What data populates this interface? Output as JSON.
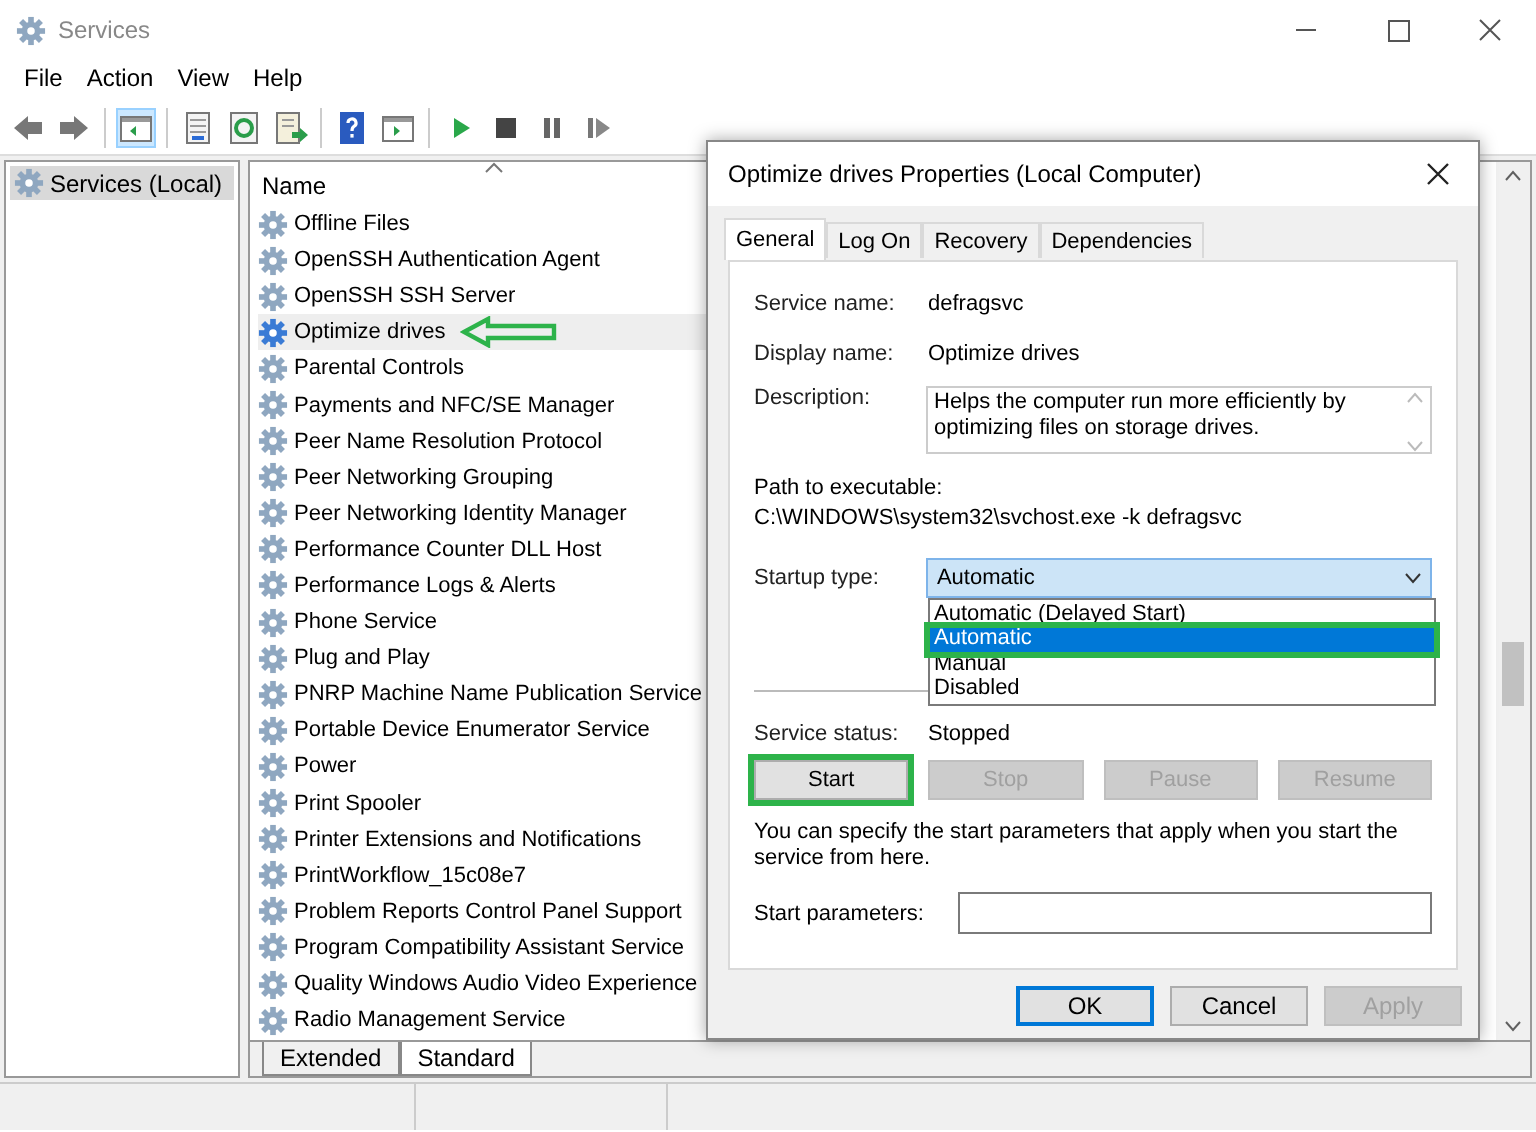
{
  "window": {
    "title": "Services"
  },
  "menu": [
    "File",
    "Action",
    "View",
    "Help"
  ],
  "tree": [
    {
      "label": "Services (Local)",
      "selected": true
    }
  ],
  "list": {
    "column": "Name",
    "rows": [
      {
        "name": "Offline Files",
        "selected": false,
        "annotated": false
      },
      {
        "name": "OpenSSH Authentication Agent",
        "selected": false,
        "annotated": false
      },
      {
        "name": "OpenSSH SSH Server",
        "selected": false,
        "annotated": false
      },
      {
        "name": "Optimize drives",
        "selected": true,
        "annotated": true
      },
      {
        "name": "Parental Controls",
        "selected": false,
        "annotated": false
      },
      {
        "name": "Payments and NFC/SE Manager",
        "selected": false,
        "annotated": false
      },
      {
        "name": "Peer Name Resolution Protocol",
        "selected": false,
        "annotated": false
      },
      {
        "name": "Peer Networking Grouping",
        "selected": false,
        "annotated": false
      },
      {
        "name": "Peer Networking Identity Manager",
        "selected": false,
        "annotated": false
      },
      {
        "name": "Performance Counter DLL Host",
        "selected": false,
        "annotated": false
      },
      {
        "name": "Performance Logs & Alerts",
        "selected": false,
        "annotated": false
      },
      {
        "name": "Phone Service",
        "selected": false,
        "annotated": false
      },
      {
        "name": "Plug and Play",
        "selected": false,
        "annotated": false
      },
      {
        "name": "PNRP Machine Name Publication Service",
        "selected": false,
        "annotated": false
      },
      {
        "name": "Portable Device Enumerator Service",
        "selected": false,
        "annotated": false
      },
      {
        "name": "Power",
        "selected": false,
        "annotated": false
      },
      {
        "name": "Print Spooler",
        "selected": false,
        "annotated": false
      },
      {
        "name": "Printer Extensions and Notifications",
        "selected": false,
        "annotated": false
      },
      {
        "name": "PrintWorkflow_15c08e7",
        "selected": false,
        "annotated": false
      },
      {
        "name": "Problem Reports Control Panel Support",
        "selected": false,
        "annotated": false
      },
      {
        "name": "Program Compatibility Assistant Service",
        "selected": false,
        "annotated": false
      },
      {
        "name": "Quality Windows Audio Video Experience",
        "selected": false,
        "annotated": false
      },
      {
        "name": "Radio Management Service",
        "selected": false,
        "annotated": false
      }
    ]
  },
  "view_tabs": [
    {
      "label": "Extended",
      "selected": false
    },
    {
      "label": "Standard",
      "selected": true
    }
  ],
  "dialog": {
    "title": "Optimize drives Properties (Local Computer)",
    "tabs": [
      {
        "label": "General",
        "selected": true
      },
      {
        "label": "Log On",
        "selected": false
      },
      {
        "label": "Recovery",
        "selected": false
      },
      {
        "label": "Dependencies",
        "selected": false
      }
    ],
    "fields": [
      {
        "label": "Service name:",
        "value": "defragsvc"
      },
      {
        "label": "Display name:",
        "value": "Optimize drives"
      }
    ],
    "description": {
      "label": "Description:",
      "value": "Helps the computer run more efficiently by optimizing files on storage drives."
    },
    "path": {
      "label": "Path to executable:",
      "value": "C:\\WINDOWS\\system32\\svchost.exe -k defragsvc"
    },
    "startup": {
      "label": "Startup type:",
      "value": "Automatic",
      "expanded": true,
      "options": [
        {
          "label": "Automatic (Delayed Start)",
          "selected": false,
          "annotated": false
        },
        {
          "label": "Automatic",
          "selected": true,
          "annotated": true
        },
        {
          "label": "Manual",
          "selected": false,
          "annotated": false
        },
        {
          "label": "Disabled",
          "selected": false,
          "annotated": false
        }
      ]
    },
    "status": {
      "label": "Service status:",
      "value": "Stopped"
    },
    "service_buttons": [
      {
        "label": "Start",
        "disabled": false,
        "annotated": true
      },
      {
        "label": "Stop",
        "disabled": true,
        "annotated": false
      },
      {
        "label": "Pause",
        "disabled": true,
        "annotated": false
      },
      {
        "label": "Resume",
        "disabled": true,
        "annotated": false
      }
    ],
    "hint": "You can specify the start parameters that apply when you start the service from here.",
    "params": {
      "label": "Start parameters:"
    },
    "buttons": [
      {
        "label": "OK",
        "default": true,
        "disabled": false
      },
      {
        "label": "Cancel",
        "default": false,
        "disabled": false
      },
      {
        "label": "Apply",
        "default": false,
        "disabled": true
      }
    ]
  }
}
